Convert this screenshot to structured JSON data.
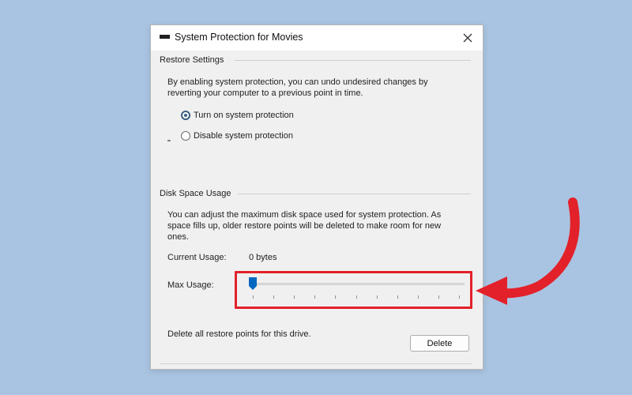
{
  "window": {
    "title": "System Protection for Movies",
    "close_icon": "close-icon"
  },
  "restore_settings": {
    "group_title": "Restore Settings",
    "description": "By enabling system protection, you can undo undesired changes by reverting your computer to a previous point in time.",
    "marker": "''",
    "options": [
      {
        "label": "Turn on system protection",
        "selected": true
      },
      {
        "label": "Disable system protection",
        "selected": false
      }
    ]
  },
  "disk_space": {
    "group_title": "Disk Space Usage",
    "description": "You can adjust the maximum disk space used for system protection. As space fills up, older restore points will be deleted to make room for new ones.",
    "current_usage_label": "Current Usage:",
    "current_usage_value": "0 bytes",
    "max_usage_label": "Max Usage:",
    "max_usage_fraction": 0.0,
    "delete_text": "Delete all restore points for this drive.",
    "delete_button": "Delete"
  },
  "colors": {
    "background": "#a9c4e2",
    "highlight": "#e3212a",
    "slider_thumb": "#0067c0",
    "arrow": "#e3212a"
  }
}
